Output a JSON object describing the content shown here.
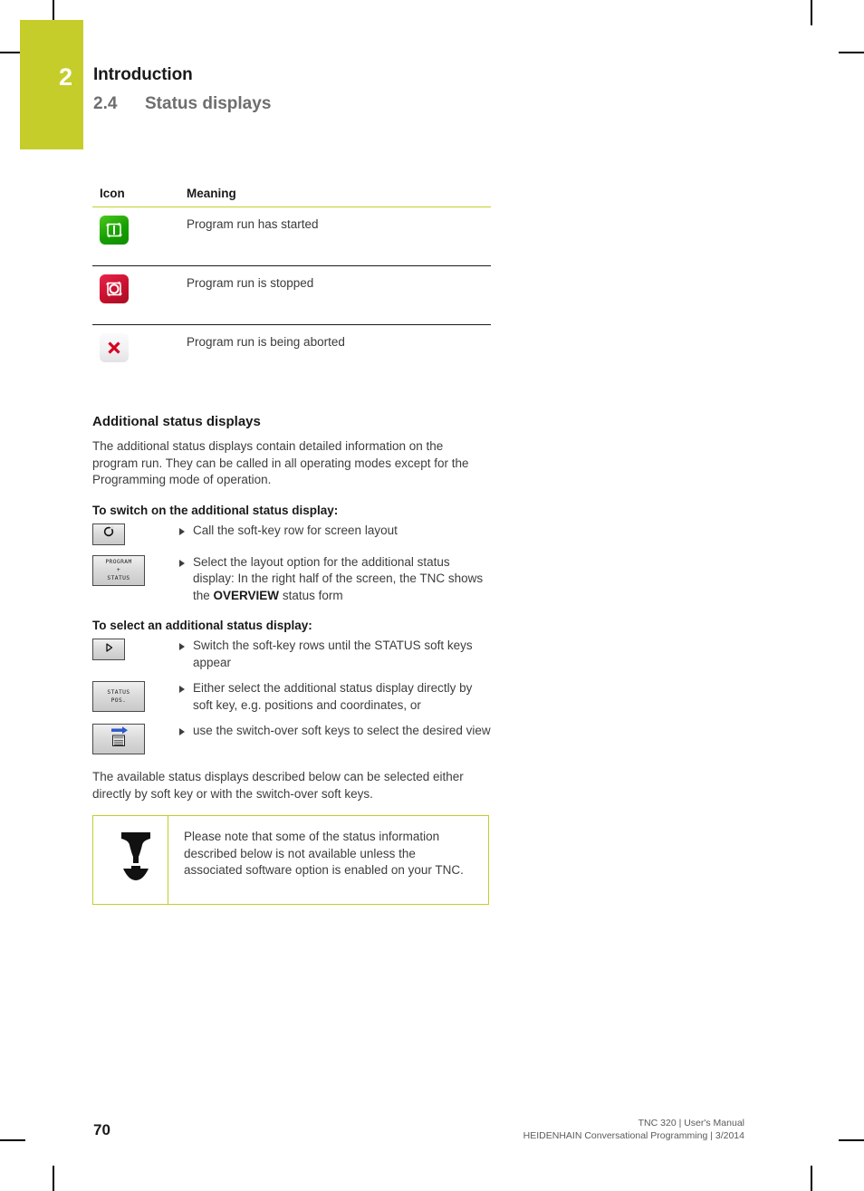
{
  "chapter": {
    "number": "2",
    "title": "Introduction",
    "section_number": "2.4",
    "section_title": "Status displays"
  },
  "icon_table": {
    "headers": {
      "icon": "Icon",
      "meaning": "Meaning"
    },
    "rows": [
      {
        "icon_name": "program-run-started-icon",
        "icon_style": "green",
        "meaning": "Program run has started"
      },
      {
        "icon_name": "program-run-stopped-icon",
        "icon_style": "red",
        "meaning": "Program run is stopped"
      },
      {
        "icon_name": "program-run-aborted-icon",
        "icon_style": "white",
        "meaning": "Program run is being aborted"
      }
    ]
  },
  "additional": {
    "heading": "Additional status displays",
    "intro": "The additional status displays contain detailed information on the program run. They can be called in all operating modes except for the Programming mode of operation.",
    "switch_on_title": "To switch on the additional status display:",
    "steps_switch_on": [
      {
        "key_type": "small",
        "key_icon": "screen-layout-circle-icon",
        "key_label": "",
        "text_prefix": "Call the soft-key row for screen layout",
        "text_bold": "",
        "text_suffix": ""
      },
      {
        "key_type": "wide",
        "key_icon": "",
        "key_label_line1": "PROGRAM",
        "key_label_line2": "+",
        "key_label_line3": "STATUS",
        "text_prefix": "Select the layout option for the additional status display: In the right half of the screen, the TNC shows the ",
        "text_bold": "OVERVIEW",
        "text_suffix": " status form"
      }
    ],
    "select_title": "To select an additional status display:",
    "steps_select": [
      {
        "key_type": "small",
        "key_icon": "arrow-right-triangle-icon",
        "text_prefix": "Switch the soft-key rows until the STATUS soft keys appear",
        "text_bold": "",
        "text_suffix": ""
      },
      {
        "key_type": "wide",
        "key_icon": "",
        "key_label_line1": "STATUS",
        "key_label_line2": "POS.",
        "text_prefix": "Either select the additional status display directly by soft key, e.g. positions and coordinates, or",
        "text_bold": "",
        "text_suffix": ""
      },
      {
        "key_type": "wide",
        "key_icon": "switch-over-arrow-document-icon",
        "text_prefix": "use the switch-over soft keys to select the desired view",
        "text_bold": "",
        "text_suffix": ""
      }
    ],
    "closing": "The available status displays described below can be selected either directly by soft key or with the switch-over soft keys."
  },
  "note": {
    "icon_name": "note-tool-icon",
    "text": "Please note that some of the status information described below is not available unless the associated software option is enabled on your TNC."
  },
  "footer": {
    "page_number": "70",
    "line1": "TNC 320 | User's Manual",
    "line2": "HEIDENHAIN Conversational Programming | 3/2014"
  },
  "colors": {
    "accent_olive": "#c5cd2b",
    "status_green": "#16a000",
    "status_red": "#c8102e",
    "heading_grey": "#6e6e6e"
  }
}
